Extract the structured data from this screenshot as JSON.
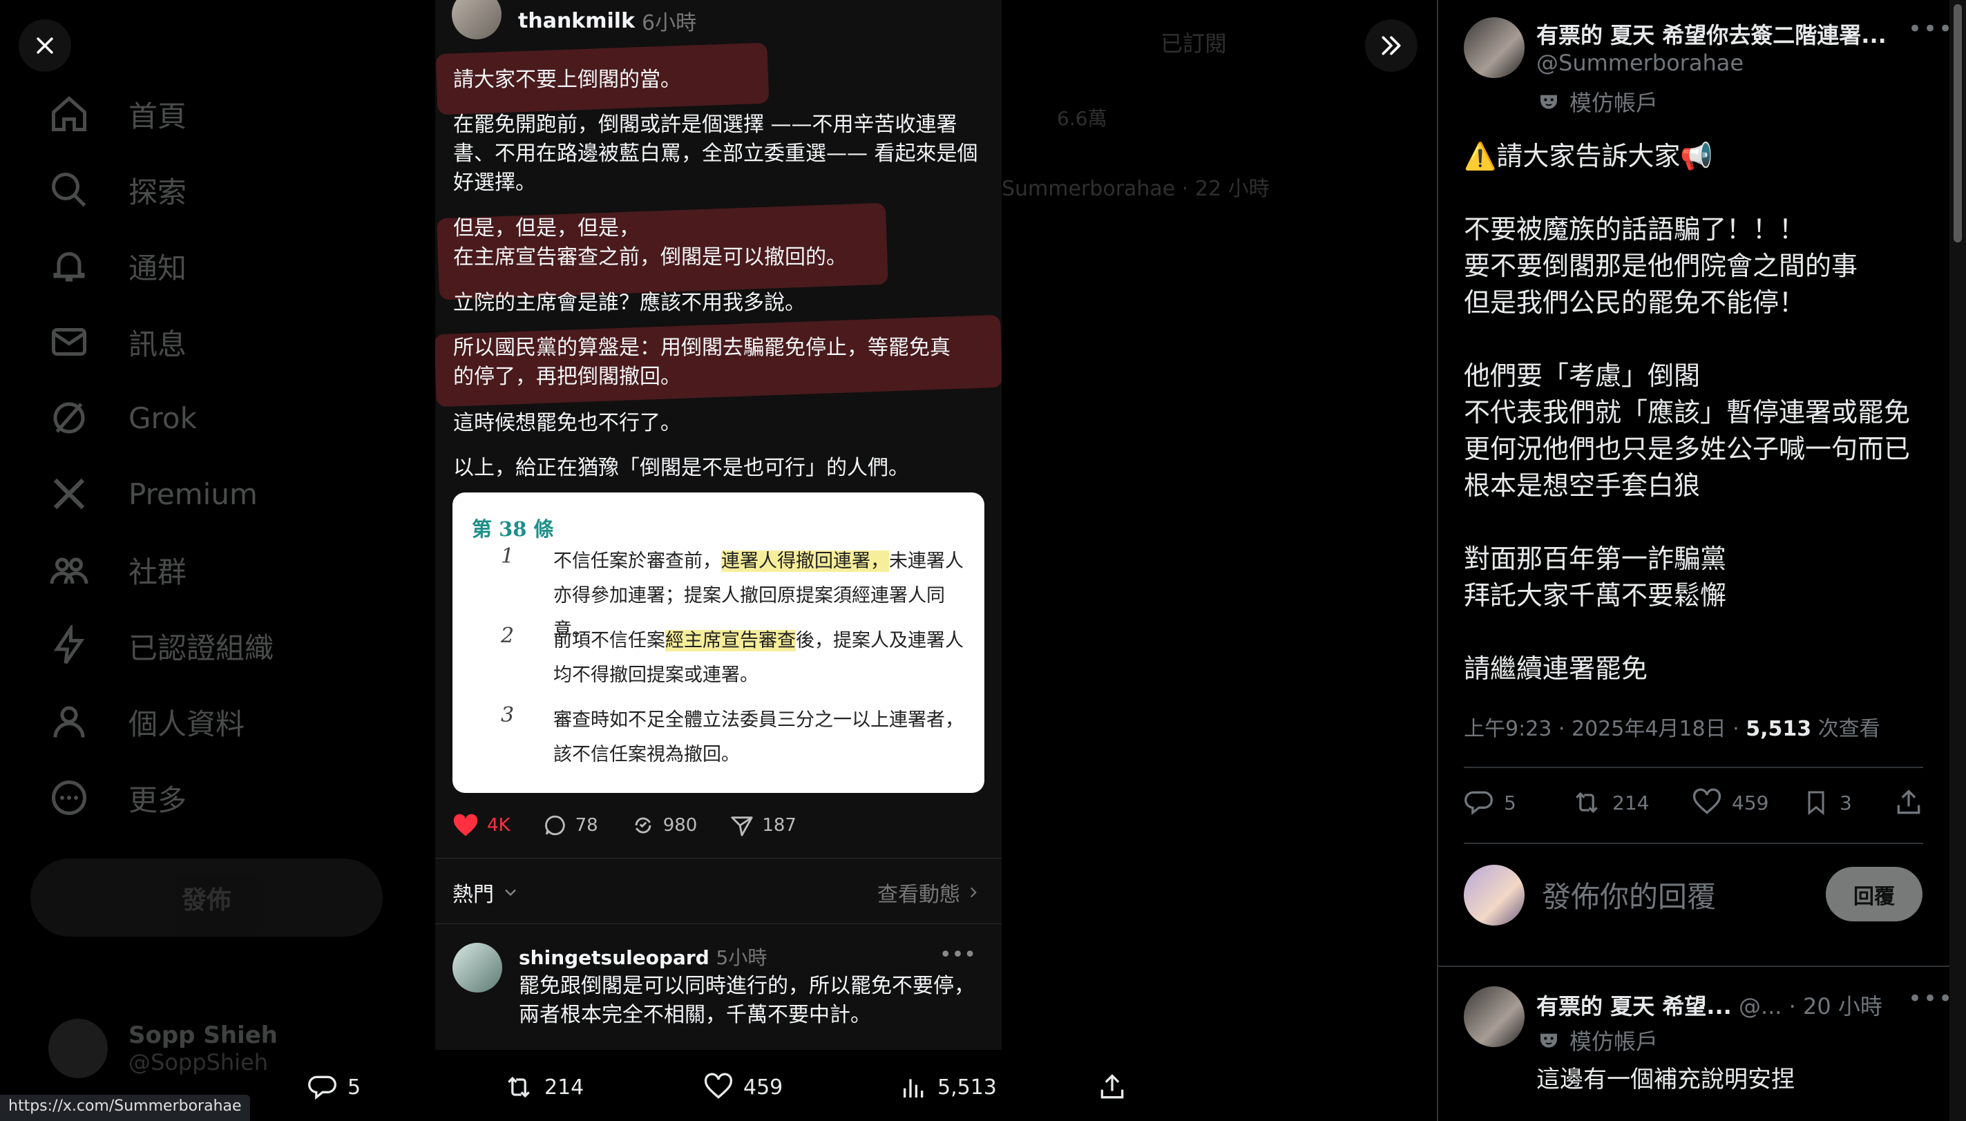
{
  "background": {
    "nav": [
      {
        "label": "首頁",
        "icon": "home-icon"
      },
      {
        "label": "探索",
        "icon": "search-icon"
      },
      {
        "label": "通知",
        "icon": "bell-icon"
      },
      {
        "label": "訊息",
        "icon": "mail-icon"
      },
      {
        "label": "Grok",
        "icon": "grok-icon"
      },
      {
        "label": "Premium",
        "icon": "x-logo-icon"
      },
      {
        "label": "社群",
        "icon": "communities-icon"
      },
      {
        "label": "已認證組織",
        "icon": "lightning-icon"
      },
      {
        "label": "個人資料",
        "icon": "person-icon"
      },
      {
        "label": "更多",
        "icon": "more-circle-icon"
      }
    ],
    "post_button": "發佈",
    "account": {
      "name": "Sopp Shieh",
      "handle": "@SoppShieh"
    },
    "mid_subscribed": "已訂閱",
    "mid_views": "6.6萬",
    "mid_author": "Summerborahae · 22 小時"
  },
  "viewer": {
    "close_icon": "close-icon",
    "collapse_icon": "double-chevron-right-icon",
    "status_url": "https://x.com/Summerborahae",
    "bar": {
      "replies": "5",
      "reposts": "214",
      "likes": "459",
      "views": "5,513"
    }
  },
  "image": {
    "user": "thankmilk",
    "time": "6小時",
    "lines": [
      "請大家不要上倒閣的當。",
      "在罷免開跑前，倒閣或許是個選擇 ——不用辛苦收連署",
      "書、不用在路邊被藍白罵，全部立委重選—— 看起來是個",
      "好選擇。",
      "但是，但是，但是，",
      "在主席宣告審查之前，倒閣是可以撤回的。",
      "立院的主席會是誰？應該不用我多說。",
      "所以國民黨的算盤是：用倒閣去騙罷免停止，等罷免真",
      "的停了，再把倒閣撤回。",
      "這時候想罷免也不行了。",
      "以上，給正在猶豫「倒閣是不是也可行」的人們。"
    ],
    "law": {
      "title": "第 38 條",
      "c1": {
        "num": "1",
        "pre": "不信任案於審查前，",
        "hl": "連署人得撤回連署，",
        "post": "未連署人亦得參加連署；提案人撤回原提案須經連署人同意。"
      },
      "c2": {
        "num": "2",
        "pre": "前項不信任案",
        "hl": "經主席宣告審查",
        "post": "後，提案人及連署人均不得撤回提案或連署。"
      },
      "c3": {
        "num": "3",
        "text": "審查時如不足全體立法委員三分之一以上連署者，該不信任案視為撤回。"
      }
    },
    "stats": {
      "likes": "4K",
      "comments": "78",
      "reposts": "980",
      "shares": "187"
    },
    "sort_label": "熱門",
    "activity_label": "查看動態",
    "reply": {
      "user": "shingetsuleopard",
      "time": "5小時",
      "line1": "罷免跟倒閣是可以同時進行的，所以罷免不要停，",
      "line2": "兩者根本完全不相關，千萬不要中計。"
    }
  },
  "tweet": {
    "author_name": "有票的 夏天 希望你去簽二階連署...",
    "author_handle": "@Summerborahae",
    "parody_label": "模仿帳戶",
    "body": "⚠️請大家告訴大家📢\n\n不要被魔族的話語騙了！！！\n要不要倒閣那是他們院會之間的事\n但是我們公民的罷免不能停！\n\n他們要「考慮」倒閣\n不代表我們就「應該」暫停連署或罷免\n更何況他們也只是多姓公子喊一句而已\n根本是想空手套白狼\n\n對面那百年第一詐騙黨\n拜託大家千萬不要鬆懈\n\n請繼續連署罷免",
    "time": "上午9:23 · 2025年4月18日 · ",
    "views": "5,513",
    "views_label": " 次查看",
    "actions": {
      "replies": "5",
      "reposts": "214",
      "likes": "459",
      "bookmarks": "3"
    },
    "reply_placeholder": "發佈你的回覆",
    "reply_button": "回覆",
    "reply": {
      "author_name": "有票的 夏天 希望...",
      "meta": " @... · 20 小時",
      "parody_label": "模仿帳戶",
      "text": "這邊有一個補充說明安捏"
    }
  },
  "colors": {
    "accent": "#1d9bf0",
    "like": "#ff3040",
    "highlight": "#4a1a1c"
  }
}
